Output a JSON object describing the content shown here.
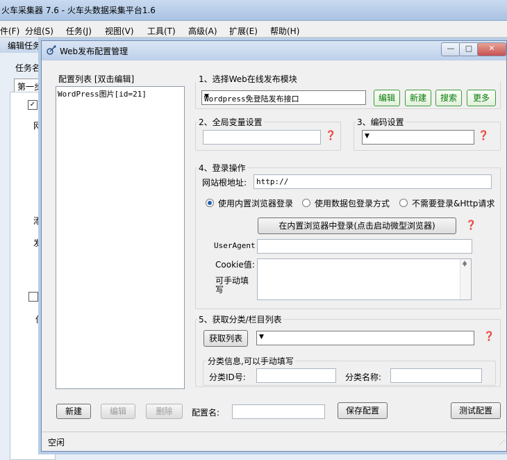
{
  "main_window": {
    "title": "火车采集器 7.6 - 火车头数据采集平台1.6",
    "menu": [
      "件(F)",
      "分组(S)",
      "任务(J)",
      "视图(V)",
      "工具(T)",
      "高级(A)",
      "扩展(E)",
      "帮助(H)"
    ],
    "edit_window_title": "编辑任务",
    "task_label": "任务名",
    "step_tab": "第一步",
    "side_text": [
      "网",
      "添",
      "发",
      "保"
    ]
  },
  "dialog": {
    "title": "Web发布配置管理",
    "window_buttons": {
      "minimize": "—",
      "maximize": "□",
      "close": "✕"
    },
    "config_list": {
      "label": "配置列表  [双击编辑]",
      "items": [
        "WordPress图片[id=21]"
      ]
    },
    "section1": {
      "label": "1、选择Web在线发布模块",
      "module_selected": "Wordpress免登陆发布接口",
      "buttons": [
        "编辑",
        "新建",
        "搜索",
        "更多"
      ]
    },
    "section2": {
      "label": "2、全局变量设置",
      "value": ""
    },
    "section3": {
      "label": "3、编码设置",
      "value": ""
    },
    "section4": {
      "label": "4、登录操作",
      "root_label": "网站根地址:",
      "root_value": "http://",
      "radio_options": [
        "使用内置浏览器登录",
        "使用数据包登录方式",
        "不需要登录&Http请求"
      ],
      "radio_selected": 0,
      "login_button": "在内置浏览器中登录(点击启动微型浏览器)",
      "useragent_label": "UserAgent",
      "useragent_value": "",
      "cookie_label": "Cookie值:",
      "cookie_hint": "可手动填写",
      "cookie_value": ""
    },
    "section5": {
      "label": "5、获取分类/栏目列表",
      "fetch_button": "获取列表",
      "category_selected": "",
      "info_group_label": "分类信息,可以手动填写",
      "id_label": "分类ID号:",
      "id_value": "",
      "name_label": "分类名称:",
      "name_value": ""
    },
    "bottom": {
      "new_button": "新建",
      "edit_button": "编辑",
      "delete_button": "删除",
      "config_name_label": "配置名:",
      "config_name_value": "",
      "save_button": "保存配置",
      "test_button": "测试配置"
    },
    "status": "空闲"
  }
}
